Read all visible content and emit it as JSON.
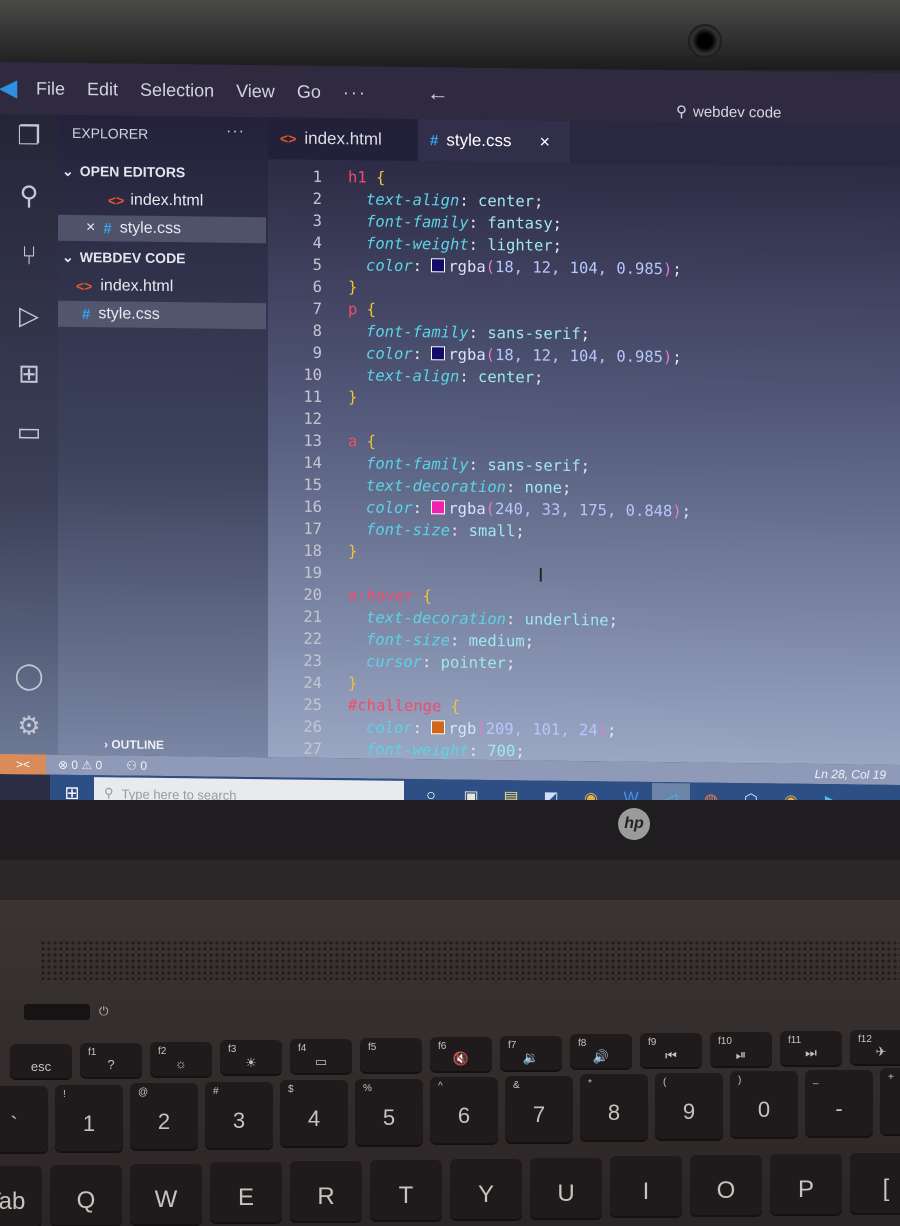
{
  "window": {
    "menu": [
      "File",
      "Edit",
      "Selection",
      "View",
      "Go",
      "···"
    ],
    "back_icon": "arrow-left-icon",
    "command_center": "webdev code"
  },
  "activity_bar": [
    "explorer-icon",
    "search-icon",
    "source-control-icon",
    "run-debug-icon",
    "extensions-icon",
    "remote-explorer-icon",
    "account-icon",
    "settings-gear-icon"
  ],
  "sidebar": {
    "title": "EXPLORER",
    "more": "···",
    "open_editors": {
      "label": "OPEN EDITORS",
      "items": [
        {
          "name": "index.html",
          "icon": "html-icon",
          "selected": false
        },
        {
          "name": "style.css",
          "icon": "css-icon",
          "selected": true,
          "close": "×"
        }
      ]
    },
    "folder": {
      "label": "WEBDEV CODE",
      "items": [
        {
          "name": "index.html",
          "icon": "html-icon",
          "selected": false
        },
        {
          "name": "style.css",
          "icon": "css-icon",
          "selected": true
        }
      ]
    },
    "outline": "OUTLINE"
  },
  "tabs": [
    {
      "label": "index.html",
      "icon": "<>",
      "active": false
    },
    {
      "label": "style.css",
      "icon": "#",
      "active": true,
      "close": "×"
    }
  ],
  "editor": {
    "lines": [
      {
        "n": "1",
        "selector": "h1",
        "open": " {"
      },
      {
        "n": "2",
        "prop": "text-align",
        "value": "center"
      },
      {
        "n": "3",
        "prop": "font-family",
        "value": "fantasy"
      },
      {
        "n": "4",
        "prop": "font-weight",
        "value": "lighter"
      },
      {
        "n": "5",
        "prop": "color",
        "fn": "rgba",
        "args": "18, 12, 104, 0.985",
        "swatch": "#120c68"
      },
      {
        "n": "6",
        "close": "}"
      },
      {
        "n": "7",
        "selector": "p",
        "open": " {"
      },
      {
        "n": "8",
        "prop": "font-family",
        "value": "sans-serif"
      },
      {
        "n": "9",
        "prop": "color",
        "fn": "rgba",
        "args": "18, 12, 104, 0.985",
        "swatch": "#120c68"
      },
      {
        "n": "10",
        "prop": "text-align",
        "value": "center"
      },
      {
        "n": "11",
        "close": "}"
      },
      {
        "n": "12"
      },
      {
        "n": "13",
        "selector": "a",
        "open": " {"
      },
      {
        "n": "14",
        "prop": "font-family",
        "value": "sans-serif"
      },
      {
        "n": "15",
        "prop": "text-decoration",
        "value": "none"
      },
      {
        "n": "16",
        "prop": "color",
        "fn": "rgba",
        "args": "240, 33, 175, 0.848",
        "swatch": "#f021af"
      },
      {
        "n": "17",
        "prop": "font-size",
        "value": "small"
      },
      {
        "n": "18",
        "close": "}"
      },
      {
        "n": "19"
      },
      {
        "n": "20",
        "selector": "a:hover",
        "open": " {"
      },
      {
        "n": "21",
        "prop": "text-decoration",
        "value": "underline"
      },
      {
        "n": "22",
        "prop": "font-size",
        "value": "medium"
      },
      {
        "n": "23",
        "prop": "cursor",
        "value": "pointer"
      },
      {
        "n": "24",
        "close": "}"
      },
      {
        "n": "25",
        "selector": "#challenge",
        "open": " {"
      },
      {
        "n": "26",
        "prop": "color",
        "fn": "rgb",
        "args": "209, 101, 24",
        "swatch": "#d16518"
      },
      {
        "n": "27",
        "prop": "font-weight",
        "value": "700"
      }
    ]
  },
  "statusbar": {
    "remote": "><",
    "errors": "0",
    "warnings": "0",
    "ports": "0",
    "position": "Ln 28, Col 19"
  },
  "taskbar": {
    "search_placeholder": "Type here to search",
    "apps": [
      {
        "name": "cortana",
        "glyph": "○",
        "running": false,
        "active": false
      },
      {
        "name": "microsoft-store",
        "glyph": "▣",
        "running": false,
        "active": false
      },
      {
        "name": "file-explorer",
        "glyph": "▤",
        "running": true,
        "active": false
      },
      {
        "name": "notepad",
        "glyph": "◩",
        "running": false,
        "active": false
      },
      {
        "name": "chrome",
        "glyph": "◉",
        "running": false,
        "active": false
      },
      {
        "name": "word",
        "glyph": "W",
        "running": false,
        "active": false
      },
      {
        "name": "vscode",
        "glyph": "◁",
        "running": true,
        "active": true
      },
      {
        "name": "firefox",
        "glyph": "◍",
        "running": false,
        "active": false
      },
      {
        "name": "virtualbox",
        "glyph": "⬡",
        "running": false,
        "active": false
      },
      {
        "name": "chrome-profile",
        "glyph": "◉",
        "running": true,
        "active": false
      },
      {
        "name": "media-player",
        "glyph": "▶",
        "running": true,
        "active": false
      }
    ]
  },
  "laptop": {
    "brand": "hp",
    "fn_row": [
      {
        "main": "esc",
        "sub": ""
      },
      {
        "main": "?",
        "sub": "f1"
      },
      {
        "main": "☼",
        "sub": "f2"
      },
      {
        "main": "☀",
        "sub": "f3"
      },
      {
        "main": "▭",
        "sub": "f4"
      },
      {
        "main": "",
        "sub": "f5"
      },
      {
        "main": "🔇",
        "sub": "f6"
      },
      {
        "main": "🔉",
        "sub": "f7"
      },
      {
        "main": "🔊",
        "sub": "f8"
      },
      {
        "main": "⏮",
        "sub": "f9"
      },
      {
        "main": "⏯",
        "sub": "f10"
      },
      {
        "main": "⏭",
        "sub": "f11"
      },
      {
        "main": "✈",
        "sub": "f12"
      }
    ],
    "num_row": [
      {
        "main": "`",
        "sub": "~"
      },
      {
        "main": "1",
        "sub": "!"
      },
      {
        "main": "2",
        "sub": "@"
      },
      {
        "main": "3",
        "sub": "#"
      },
      {
        "main": "4",
        "sub": "$"
      },
      {
        "main": "5",
        "sub": "%"
      },
      {
        "main": "6",
        "sub": "^"
      },
      {
        "main": "7",
        "sub": "&"
      },
      {
        "main": "8",
        "sub": "*"
      },
      {
        "main": "9",
        "sub": "("
      },
      {
        "main": "0",
        "sub": ")"
      },
      {
        "main": "-",
        "sub": "_"
      },
      {
        "main": "=",
        "sub": "+"
      }
    ],
    "letter_row": [
      "Tab",
      "Q",
      "W",
      "E",
      "R",
      "T",
      "Y",
      "U",
      "I",
      "O",
      "P",
      "["
    ]
  }
}
